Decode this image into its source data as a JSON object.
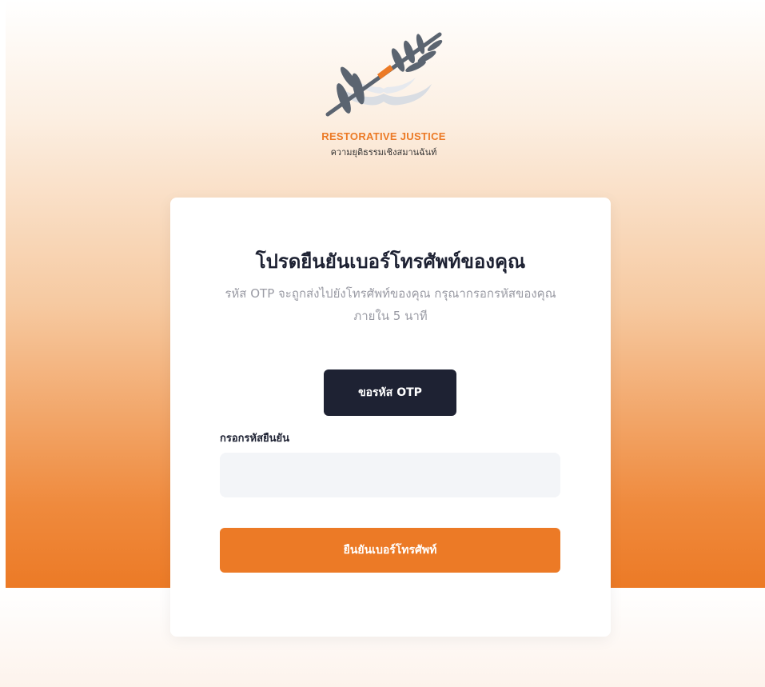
{
  "brand": {
    "name_en": "RESTORATIVE JUSTICE",
    "name_th": "ความยุติธรรมเชิงสมานฉันท์"
  },
  "card": {
    "title": "โปรดยืนยันเบอร์โทรศัพท์ของคุณ",
    "subtitle": "รหัส OTP จะถูกส่งไปยังโทรศัพท์ของคุณ กรุณากรอกรหัสของคุณภายใน 5 นาที",
    "request_otp_label": "ขอรหัส OTP",
    "code_label": "กรอกรหัสยืนยัน",
    "code_value": "",
    "code_placeholder": "",
    "confirm_label": "ยืนยันเบอร์โทรศัพท์"
  },
  "colors": {
    "accent": "#ec7a26",
    "dark": "#1e2233",
    "input_bg": "#f3f5f8"
  },
  "icons": {
    "logo": "olive-branch-hands-logo"
  }
}
